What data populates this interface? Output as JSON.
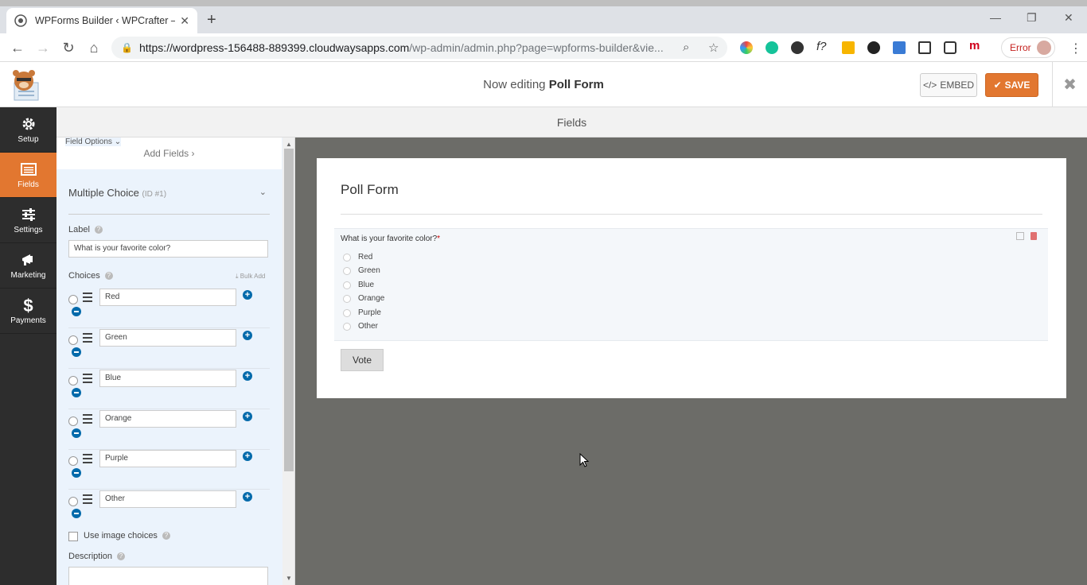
{
  "browser": {
    "tab_title": "WPForms Builder ‹ WPCrafter —",
    "url_main": "https://wordpress-156488-889399.cloudwaysapps.com",
    "url_path": "/wp-admin/admin.php?page=wpforms-builder&vie...",
    "error_label": "Error"
  },
  "header": {
    "editing_prefix": "Now editing",
    "form_name": "Poll Form",
    "embed_label": "EMBED",
    "save_label": "SAVE"
  },
  "sidebar": {
    "items": [
      {
        "label": "Setup",
        "icon": "gear-icon"
      },
      {
        "label": "Fields",
        "icon": "list-icon"
      },
      {
        "label": "Settings",
        "icon": "sliders-icon"
      },
      {
        "label": "Marketing",
        "icon": "megaphone-icon"
      },
      {
        "label": "Payments",
        "icon": "dollar-icon"
      }
    ]
  },
  "fields_bar": {
    "title": "Fields"
  },
  "panel": {
    "tab_add": "Add Fields",
    "tab_options": "Field Options",
    "field_type": "Multiple Choice",
    "field_id": "(ID #1)",
    "label_title": "Label",
    "label_value": "What is your favorite color?",
    "choices_title": "Choices",
    "bulk_add": "Bulk Add",
    "choices": [
      "Red",
      "Green",
      "Blue",
      "Orange",
      "Purple",
      "Other"
    ],
    "image_choices": "Use image choices",
    "description_title": "Description"
  },
  "preview": {
    "title": "Poll Form",
    "question": "What is your favorite color?",
    "required_mark": "*",
    "options": [
      "Red",
      "Green",
      "Blue",
      "Orange",
      "Purple",
      "Other"
    ],
    "submit": "Vote"
  },
  "colors": {
    "accent": "#e27730",
    "sidebar": "#2d2d2d",
    "panel": "#ebf3fc",
    "link": "#036aab"
  }
}
